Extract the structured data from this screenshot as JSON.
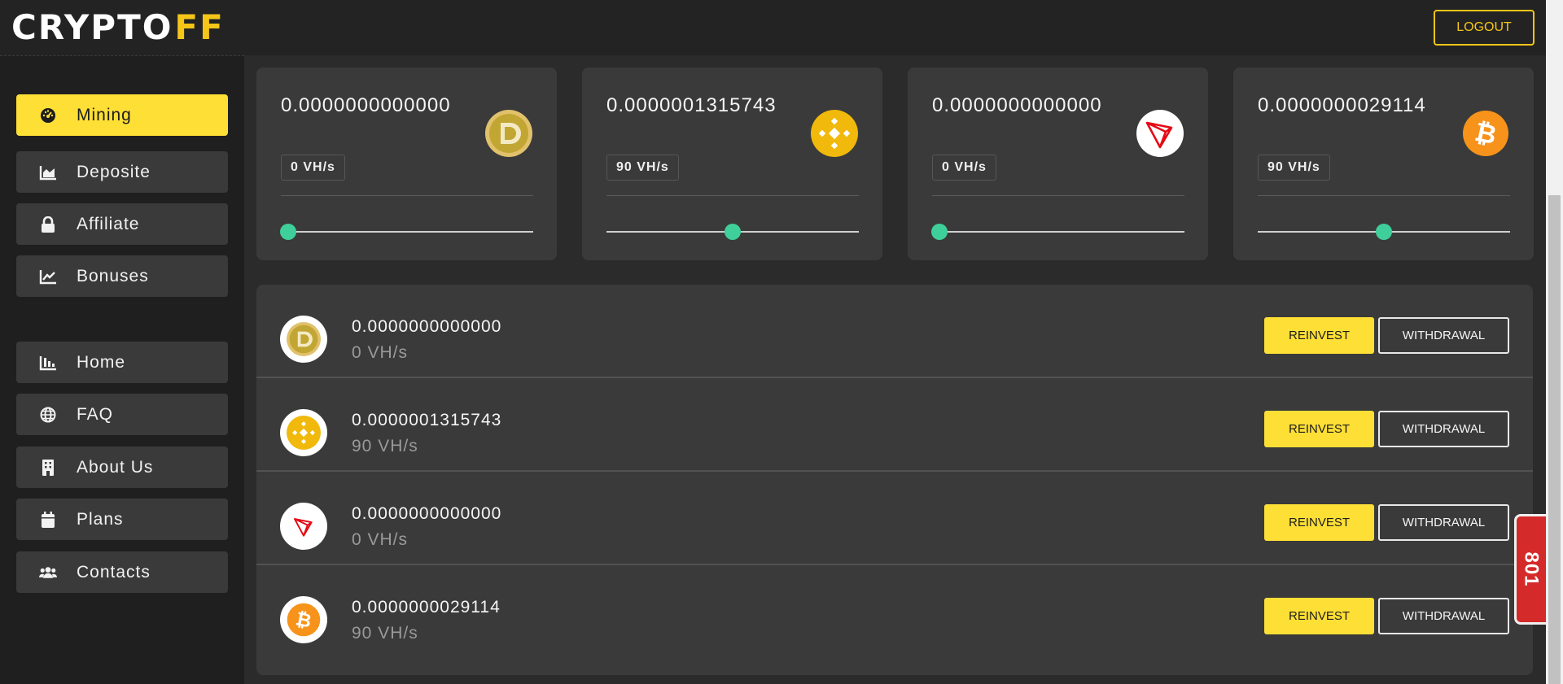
{
  "header": {
    "logo_text": "CRYPTO",
    "logo_accent": "FF",
    "logout_label": "LOGOUT"
  },
  "sidebar": {
    "items": [
      {
        "label": "Mining",
        "icon": "dashboard-gauge-icon",
        "active": true
      },
      {
        "label": "Deposite",
        "icon": "area-chart-icon"
      },
      {
        "label": "Affiliate",
        "icon": "lock-icon"
      },
      {
        "label": "Bonuses",
        "icon": "line-chart-icon"
      },
      {
        "label": "Home",
        "icon": "bar-chart-icon"
      },
      {
        "label": "FAQ",
        "icon": "globe-icon"
      },
      {
        "label": "About Us",
        "icon": "building-icon"
      },
      {
        "label": "Plans",
        "icon": "calendar-icon"
      },
      {
        "label": "Contacts",
        "icon": "users-icon"
      }
    ]
  },
  "cards": [
    {
      "coin": "dogecoin",
      "amount": "0.0000000000000",
      "speed": "0 VH/s",
      "slider_fraction": 0.03
    },
    {
      "coin": "bnb",
      "amount": "0.0000001315743",
      "speed": "90 VH/s",
      "slider_fraction": 0.5
    },
    {
      "coin": "tron",
      "amount": "0.0000000000000",
      "speed": "0 VH/s",
      "slider_fraction": 0.03
    },
    {
      "coin": "bitcoin",
      "amount": "0.0000000029114",
      "speed": "90 VH/s",
      "slider_fraction": 0.5
    }
  ],
  "rows": [
    {
      "coin": "dogecoin",
      "amount": "0.0000000000000",
      "speed": "0 VH/s",
      "reinvest_label": "REINVEST",
      "withdrawal_label": "WITHDRAWAL"
    },
    {
      "coin": "bnb",
      "amount": "0.0000001315743",
      "speed": "90 VH/s",
      "reinvest_label": "REINVEST",
      "withdrawal_label": "WITHDRAWAL"
    },
    {
      "coin": "tron",
      "amount": "0.0000000000000",
      "speed": "0 VH/s",
      "reinvest_label": "REINVEST",
      "withdrawal_label": "WITHDRAWAL"
    },
    {
      "coin": "bitcoin",
      "amount": "0.0000000029114",
      "speed": "90 VH/s",
      "reinvest_label": "REINVEST",
      "withdrawal_label": "WITHDRAWAL"
    }
  ],
  "side_tab_text": "801",
  "colors": {
    "accent_yellow": "#fddf35",
    "slider_knob": "#3fcf9b",
    "bnb": "#f0b90b",
    "tron": "#e50915",
    "bitcoin": "#f7931a",
    "dogecoin": "#c2a633",
    "side_tab": "#d42a2a"
  }
}
